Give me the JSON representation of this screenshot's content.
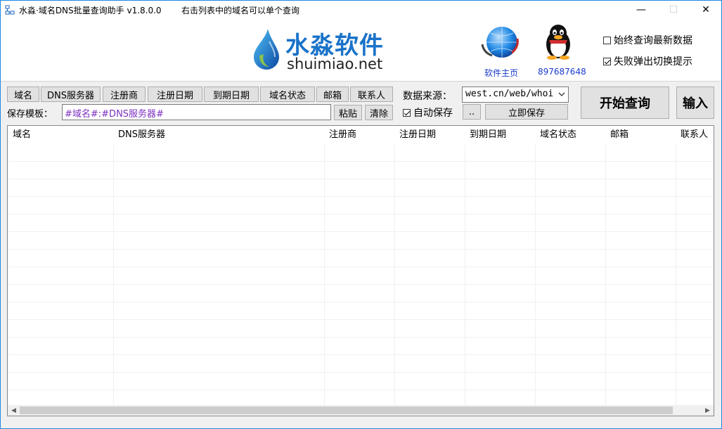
{
  "window": {
    "title": "水淼·域名DNS批量查询助手 v1.8.0.0",
    "hint": "右击列表中的域名可以单个查询",
    "minimize_glyph": "—",
    "maximize_glyph": "☐",
    "close_glyph": "✕"
  },
  "header": {
    "logo_cn": "水淼软件",
    "logo_en": "shuimiao.net",
    "home_label": "软件主页",
    "qq_label": "897687648",
    "always_latest": "始终查询最新数据",
    "fail_popup": "失败弹出切换提示"
  },
  "fields": [
    "域名",
    "DNS服务器",
    "注册商",
    "注册日期",
    "到期日期",
    "域名状态",
    "邮箱",
    "联系人"
  ],
  "template": {
    "label": "保存模板：",
    "value": "#域名#:#DNS服务器#",
    "paste": "粘贴",
    "clear": "清除"
  },
  "source": {
    "label": "数据来源：",
    "value": "west.cn/web/whoi",
    "auto_save": "自动保存",
    "browse": "..",
    "save_now": "立即保存"
  },
  "actions": {
    "start": "开始查询",
    "input": "输入"
  },
  "grid": {
    "columns": [
      "域名",
      "DNS服务器",
      "注册商",
      "注册日期",
      "到期日期",
      "域名状态",
      "邮箱",
      "联系人"
    ]
  },
  "colors": {
    "accent": "#1e88e5",
    "template_text": "#7b2fbf",
    "logo_blue": "#1a73c9"
  },
  "icons": {
    "app": "network-icon",
    "home": "globe-icon",
    "qq": "penguin-icon"
  }
}
